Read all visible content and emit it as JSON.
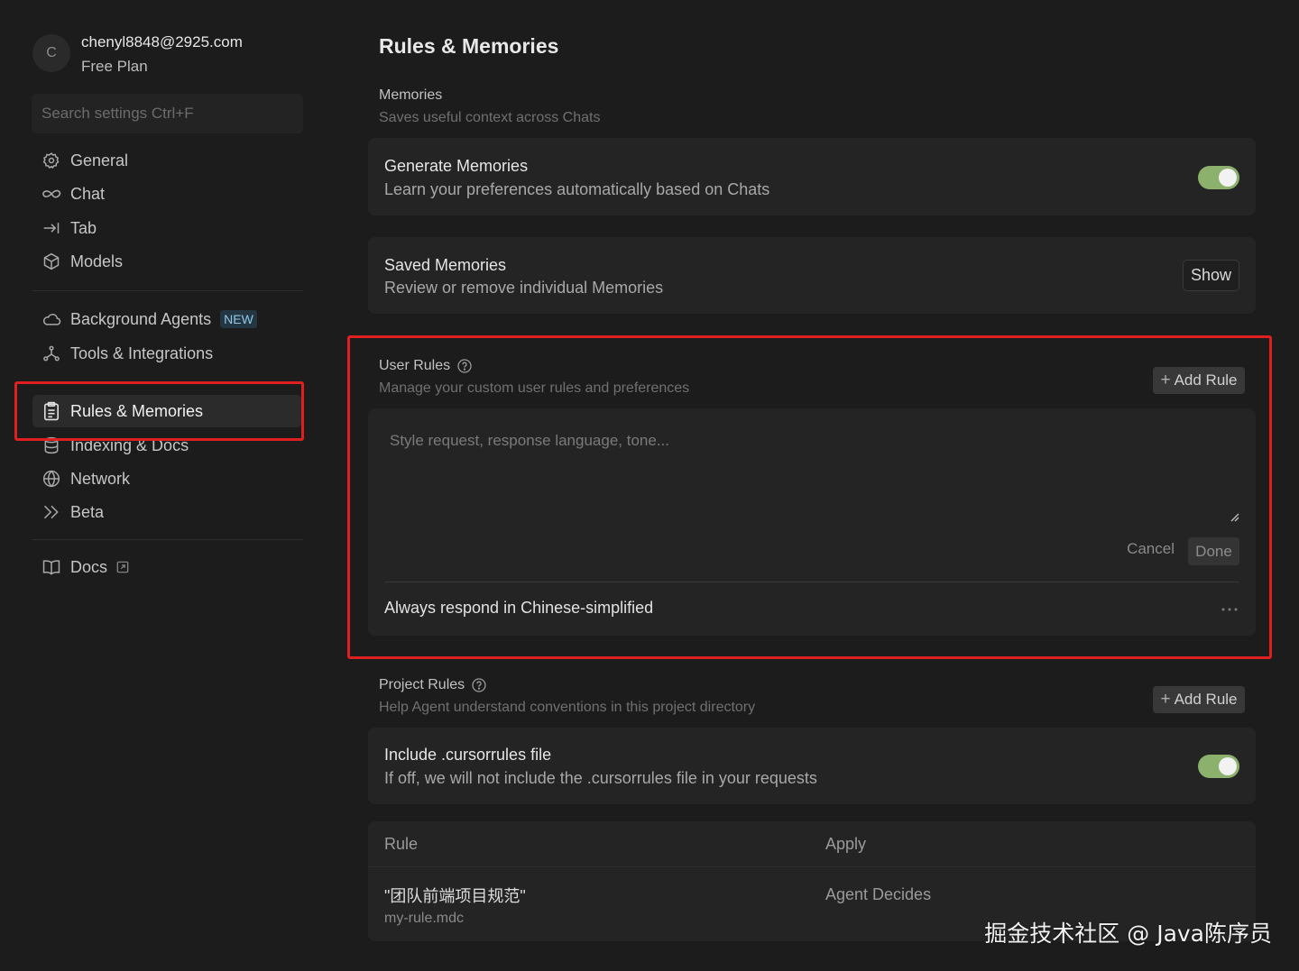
{
  "account": {
    "avatar_initial": "C",
    "email": "chenyl8848@2925.com",
    "plan": "Free Plan"
  },
  "search": {
    "placeholder": "Search settings Ctrl+F"
  },
  "sidebar": {
    "items": [
      {
        "label": "General",
        "icon": "gear-icon"
      },
      {
        "label": "Chat",
        "icon": "infinity-icon"
      },
      {
        "label": "Tab",
        "icon": "tab-arrow-icon"
      },
      {
        "label": "Models",
        "icon": "cube-icon"
      },
      {
        "label": "Background Agents",
        "icon": "cloud-icon",
        "badge": "NEW"
      },
      {
        "label": "Tools & Integrations",
        "icon": "integration-icon"
      },
      {
        "label": "Rules & Memories",
        "icon": "clipboard-icon",
        "active": true
      },
      {
        "label": "Indexing & Docs",
        "icon": "database-icon"
      },
      {
        "label": "Network",
        "icon": "globe-icon"
      },
      {
        "label": "Beta",
        "icon": "double-chevron-icon"
      },
      {
        "label": "Docs",
        "icon": "book-icon",
        "external": true
      }
    ]
  },
  "main": {
    "title": "Rules & Memories",
    "memories": {
      "title": "Memories",
      "desc": "Saves useful context across Chats",
      "generate": {
        "title": "Generate Memories",
        "desc": "Learn your preferences automatically based on Chats",
        "enabled": true
      },
      "saved": {
        "title": "Saved Memories",
        "desc": "Review or remove individual Memories",
        "button": "Show"
      }
    },
    "user_rules": {
      "title": "User Rules",
      "desc": "Manage your custom user rules and preferences",
      "add_button": "Add Rule",
      "textarea_placeholder": "Style request, response language, tone...",
      "cancel": "Cancel",
      "done": "Done",
      "rules": [
        "Always respond in Chinese-simplified"
      ]
    },
    "project_rules": {
      "title": "Project Rules",
      "desc": "Help Agent understand conventions in this project directory",
      "add_button": "Add Rule",
      "include_cursorrules": {
        "title": "Include .cursorrules file",
        "desc": "If off, we will not include the .cursorrules file in your requests",
        "enabled": true
      },
      "table": {
        "headers": [
          "Rule",
          "Apply"
        ],
        "rows": [
          {
            "name": "\"团队前端项目规范\"",
            "file": "my-rule.mdc",
            "apply": "Agent Decides"
          }
        ]
      }
    }
  },
  "watermark": "掘金技术社区 @ Java陈序员",
  "colors": {
    "background": "#1c1c1c",
    "card": "#242424",
    "toggle_on": "#8cb16c",
    "highlight_box": "#e02020",
    "badge_new": "#8fc8e8"
  }
}
